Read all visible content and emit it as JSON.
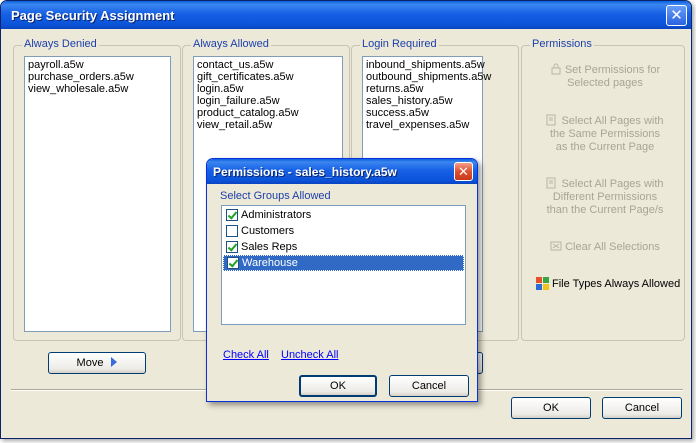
{
  "window": {
    "title": "Page Security Assignment",
    "close_glyph": "✕"
  },
  "denied": {
    "label": "Always Denied",
    "items": [
      "payroll.a5w",
      "purchase_orders.a5w",
      "view_wholesale.a5w"
    ]
  },
  "allowed": {
    "label": "Always Allowed",
    "items": [
      "contact_us.a5w",
      "gift_certificates.a5w",
      "login.a5w",
      "login_failure.a5w",
      "product_catalog.a5w",
      "view_retail.a5w"
    ]
  },
  "login": {
    "label": "Login Required",
    "items": [
      "inbound_shipments.a5w",
      "outbound_shipments.a5w",
      "returns.a5w",
      "sales_history.a5w",
      "success.a5w",
      "travel_expenses.a5w"
    ]
  },
  "permissions": {
    "label": "Permissions",
    "set_line1": "Set Permissions for",
    "set_line2": "Selected pages",
    "same_line1": "Select All Pages with",
    "same_line2": "the Same Permissions",
    "same_line3": "as the Current Page",
    "diff_line1": "Select All Pages with",
    "diff_line2": "Different Permissions",
    "diff_line3": "than the Current Page/s",
    "clear": "Clear All Selections",
    "file_types": "File Types Always Allowed"
  },
  "move_label": "Move",
  "ok_label": "OK",
  "cancel_label": "Cancel",
  "dialog": {
    "title": "Permissions - sales_history.a5w",
    "close_glyph": "✕",
    "group_label": "Select Groups Allowed",
    "groups": [
      {
        "name": "Administrators",
        "checked": true,
        "selected": false
      },
      {
        "name": "Customers",
        "checked": false,
        "selected": false
      },
      {
        "name": "Sales Reps",
        "checked": true,
        "selected": false
      },
      {
        "name": "Warehouse",
        "checked": true,
        "selected": true
      }
    ],
    "check_all": "Check All",
    "uncheck_all": "Uncheck All",
    "ok_label": "OK",
    "cancel_label": "Cancel"
  },
  "colors": {
    "title_blue": "#0b53d9",
    "group_label": "#1c3faa",
    "selection": "#316ac5",
    "link": "#0000ff"
  }
}
